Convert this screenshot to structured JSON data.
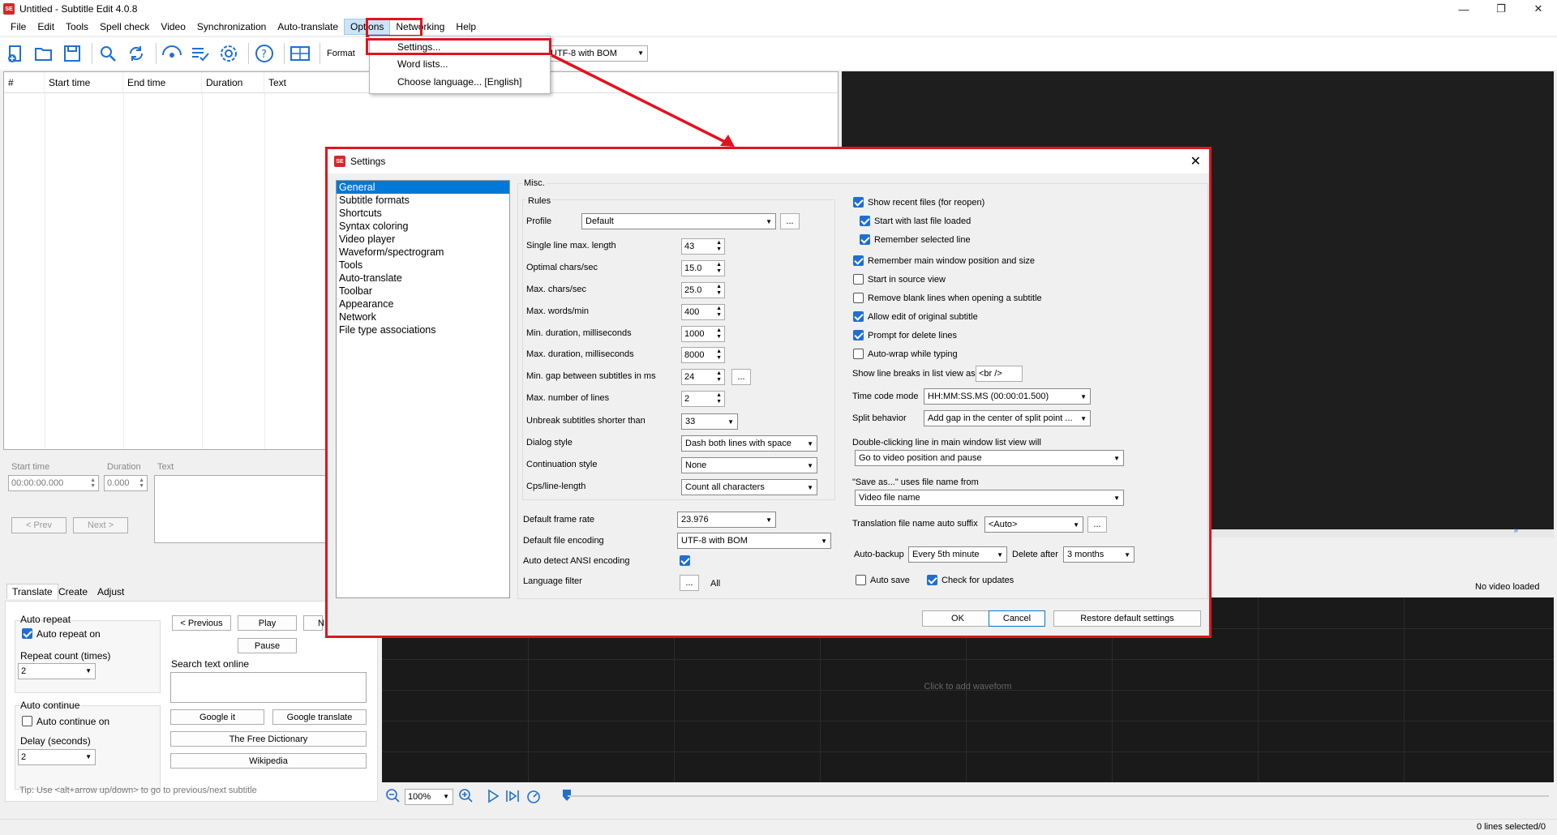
{
  "window": {
    "title": "Untitled - Subtitle Edit 4.0.8",
    "app_icon": "SE",
    "minimize": "—",
    "maximize": "❐",
    "close": "✕"
  },
  "menu": [
    "File",
    "Edit",
    "Tools",
    "Spell check",
    "Video",
    "Synchronization",
    "Auto-translate",
    "Options",
    "Networking",
    "Help"
  ],
  "toolbar": {
    "format_label": "Format",
    "encoding": "UTF-8 with BOM"
  },
  "grid": {
    "headers": [
      "#",
      "Start time",
      "End time",
      "Duration",
      "Text"
    ]
  },
  "editor": {
    "start_time_label": "Start time",
    "start_time_value": "00:00:00.000",
    "duration_label": "Duration",
    "duration_value": "0.000",
    "text_label": "Text",
    "prev": "< Prev",
    "next": "Next >"
  },
  "bottom": {
    "tabs": [
      "Translate",
      "Create",
      "Adjust"
    ],
    "auto_repeat": "Auto repeat",
    "auto_repeat_on": "Auto repeat on",
    "repeat_count": "Repeat count (times)",
    "repeat_count_value": "2",
    "auto_continue": "Auto continue",
    "auto_continue_on": "Auto continue on",
    "delay": "Delay (seconds)",
    "delay_value": "2",
    "previous": "< Previous",
    "play": "Play",
    "next_short": "N",
    "pause": "Pause",
    "search_online": "Search text online",
    "google_it": "Google it",
    "google_translate": "Google translate",
    "free_dictionary": "The Free Dictionary",
    "wikipedia": "Wikipedia",
    "tip": "Tip: Use <alt+arrow up/down> to go to previous/next subtitle"
  },
  "video": {
    "no_video": "No video loaded",
    "waveform_hint": "Click to add waveform",
    "zoom": "100%",
    "chevrons": "»"
  },
  "status": {
    "lines_selected": "0 lines selected/0"
  },
  "options_menu": {
    "items": [
      "Settings...",
      "Word lists...",
      "Choose language... [English]"
    ]
  },
  "settings": {
    "title": "Settings",
    "nav": [
      "General",
      "Subtitle formats",
      "Shortcuts",
      "Syntax coloring",
      "Video player",
      "Waveform/spectrogram",
      "Tools",
      "Auto-translate",
      "Toolbar",
      "Appearance",
      "Network",
      "File type associations"
    ],
    "misc": "Misc.",
    "rules": "Rules",
    "profile_label": "Profile",
    "profile_value": "Default",
    "ellipsis": "...",
    "fields": [
      {
        "label": "Single line max. length",
        "value": "43"
      },
      {
        "label": "Optimal chars/sec",
        "value": "15.0"
      },
      {
        "label": "Max. chars/sec",
        "value": "25.0"
      },
      {
        "label": "Max. words/min",
        "value": "400"
      },
      {
        "label": "Min. duration, milliseconds",
        "value": "1000"
      },
      {
        "label": "Max. duration, milliseconds",
        "value": "8000"
      },
      {
        "label": "Min. gap between subtitles in ms",
        "value": "24"
      },
      {
        "label": "Max. number of lines",
        "value": "2"
      }
    ],
    "unbreak_label": "Unbreak subtitles shorter than",
    "unbreak_value": "33",
    "dialog_style_label": "Dialog style",
    "dialog_style_value": "Dash both lines with space",
    "continuation_label": "Continuation style",
    "continuation_value": "None",
    "cps_label": "Cps/line-length",
    "cps_value": "Count all characters",
    "frame_rate_label": "Default frame rate",
    "frame_rate_value": "23.976",
    "encoding_label": "Default file encoding",
    "encoding_value": "UTF-8 with BOM",
    "ansi_label": "Auto detect ANSI encoding",
    "language_filter_label": "Language filter",
    "language_filter_value": "All",
    "checks": [
      {
        "label": "Show recent files (for reopen)",
        "on": true
      },
      {
        "label": "Start with last file loaded",
        "on": true
      },
      {
        "label": "Remember selected line",
        "on": true
      },
      {
        "label": "Remember main window position and size",
        "on": true
      },
      {
        "label": "Start in source view",
        "on": false
      },
      {
        "label": "Remove blank lines when opening a subtitle",
        "on": false
      },
      {
        "label": "Allow edit of original subtitle",
        "on": true
      },
      {
        "label": "Prompt for delete lines",
        "on": true
      },
      {
        "label": "Auto-wrap while typing",
        "on": false
      }
    ],
    "line_breaks_label": "Show line breaks in list view as",
    "line_breaks_value": "<br />",
    "time_code_label": "Time code mode",
    "time_code_value": "HH:MM:SS.MS (00:00:01.500)",
    "split_label": "Split behavior",
    "split_value": "Add gap in the center of split point ...",
    "dblclick_label": "Double-clicking line in main window list view will",
    "dblclick_value": "Go to video position and pause",
    "save_as_label": "\"Save as...\" uses file name from",
    "save_as_value": "Video file name",
    "translation_label": "Translation file name auto suffix",
    "translation_value": "<Auto>",
    "auto_backup_label": "Auto-backup",
    "auto_backup_value": "Every 5th minute",
    "delete_after_label": "Delete after",
    "delete_after_value": "3 months",
    "auto_save_label": "Auto save",
    "check_updates_label": "Check for updates",
    "ok": "OK",
    "cancel": "Cancel",
    "restore": "Restore default settings"
  },
  "colors": {
    "accent": "#0078d7",
    "highlight": "#e0141e",
    "brand": "#d9262b"
  }
}
